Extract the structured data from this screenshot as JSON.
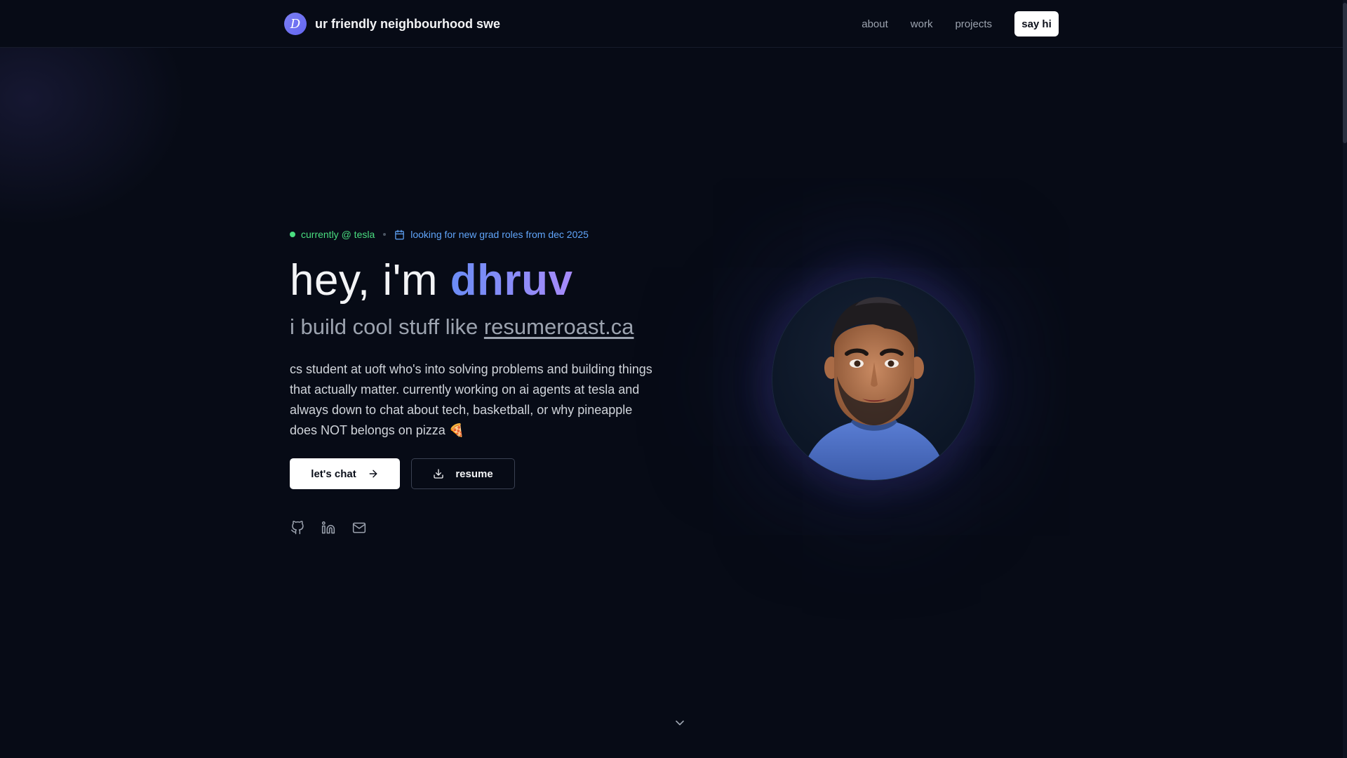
{
  "nav": {
    "logo_icon": "letter-d-logo",
    "logo_letter": "D",
    "brand": "ur friendly neighbourhood swe",
    "links": [
      "about",
      "work",
      "projects"
    ],
    "cta": "say hi"
  },
  "hero": {
    "status": "currently @ tesla",
    "looking": "looking for new grad roles from dec 2025",
    "headline_prefix": "hey, i'm ",
    "name": "dhruv",
    "sub_prefix": "i build cool stuff like ",
    "sub_link": "resumeroast.ca",
    "bio": "cs student at uoft who's into solving problems and building things that actually matter. currently working on ai agents at tesla and always down to chat about tech, basketball, or why pineapple does NOT belongs on pizza 🍕",
    "chat_button": "let's chat",
    "resume_button": "resume",
    "icons": {
      "status": "green-dot",
      "looking": "calendar-icon",
      "chat": "arrow-right-icon",
      "resume": "download-icon"
    },
    "socials": [
      "github-icon",
      "linkedin-icon",
      "mail-icon"
    ]
  },
  "avatar": {
    "icon": "3d-avatar-portrait"
  },
  "scroll_hint": {
    "icon": "chevron-down-icon"
  },
  "colors": {
    "background": "#070b16",
    "status_green": "#4ade80",
    "looking_blue": "#60a5fa",
    "name_gradient_start": "#6b8cf5",
    "name_gradient_end": "#a78bfa"
  }
}
